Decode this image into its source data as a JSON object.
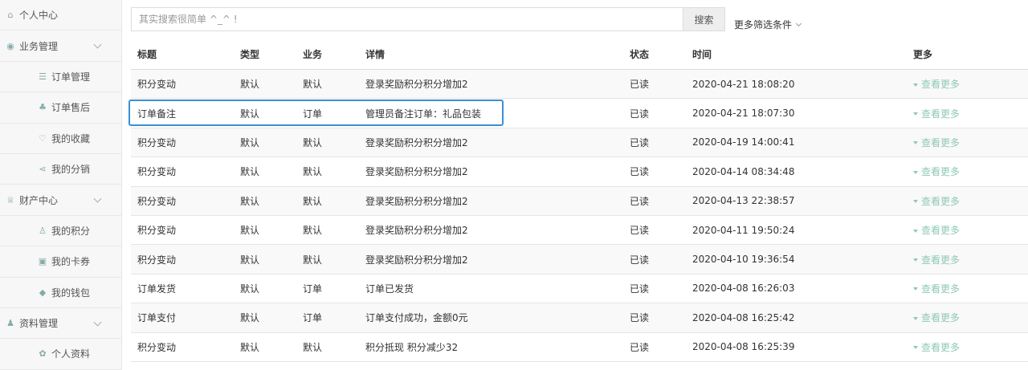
{
  "sidebar": {
    "items": [
      {
        "label": "个人中心",
        "level": "top",
        "icon": "home-icon",
        "glyph": "⌂",
        "expandable": false
      },
      {
        "label": "业务管理",
        "level": "top",
        "icon": "business-icon",
        "glyph": "◉",
        "expandable": true
      },
      {
        "label": "订单管理",
        "level": "sub",
        "icon": "list-icon",
        "glyph": "☰",
        "expandable": false
      },
      {
        "label": "订单售后",
        "level": "sub",
        "icon": "after-sale-icon",
        "glyph": "♣",
        "expandable": false
      },
      {
        "label": "我的收藏",
        "level": "sub",
        "icon": "heart-icon",
        "glyph": "♡",
        "expandable": false
      },
      {
        "label": "我的分销",
        "level": "sub",
        "icon": "share-icon",
        "glyph": "⋖",
        "expandable": false
      },
      {
        "label": "财产中心",
        "level": "top",
        "icon": "trophy-icon",
        "glyph": "♕",
        "expandable": true
      },
      {
        "label": "我的积分",
        "level": "sub",
        "icon": "points-icon",
        "glyph": "♙",
        "expandable": false
      },
      {
        "label": "我的卡券",
        "level": "sub",
        "icon": "gift-icon",
        "glyph": "▣",
        "expandable": false
      },
      {
        "label": "我的钱包",
        "level": "sub",
        "icon": "wallet-icon",
        "glyph": "◆",
        "expandable": false
      },
      {
        "label": "资料管理",
        "level": "top",
        "icon": "user-icon",
        "glyph": "♟",
        "expandable": true
      },
      {
        "label": "个人资料",
        "level": "sub",
        "icon": "settings-icon",
        "glyph": "✿",
        "expandable": false
      }
    ]
  },
  "search": {
    "placeholder": "其实搜索很简单 ^_^ !",
    "button_label": "搜索",
    "more_filters_label": "更多筛选条件"
  },
  "table": {
    "headers": {
      "title": "标题",
      "type": "类型",
      "business": "业务",
      "detail": "详情",
      "status": "状态",
      "time": "时间",
      "more": "更多"
    },
    "more_link_label": "查看更多",
    "highlighted_row": 1,
    "rows": [
      {
        "title": "积分变动",
        "type": "默认",
        "business": "默认",
        "detail": "登录奖励积分积分增加2",
        "status": "已读",
        "time": "2020-04-21 18:08:20"
      },
      {
        "title": "订单备注",
        "type": "默认",
        "business": "订单",
        "detail": "管理员备注订单：礼品包装",
        "status": "已读",
        "time": "2020-04-21 18:07:30"
      },
      {
        "title": "积分变动",
        "type": "默认",
        "business": "默认",
        "detail": "登录奖励积分积分增加2",
        "status": "已读",
        "time": "2020-04-19 14:00:41"
      },
      {
        "title": "积分变动",
        "type": "默认",
        "business": "默认",
        "detail": "登录奖励积分积分增加2",
        "status": "已读",
        "time": "2020-04-14 08:34:48"
      },
      {
        "title": "积分变动",
        "type": "默认",
        "business": "默认",
        "detail": "登录奖励积分积分增加2",
        "status": "已读",
        "time": "2020-04-13 22:38:57"
      },
      {
        "title": "积分变动",
        "type": "默认",
        "business": "默认",
        "detail": "登录奖励积分积分增加2",
        "status": "已读",
        "time": "2020-04-11 19:50:24"
      },
      {
        "title": "积分变动",
        "type": "默认",
        "business": "默认",
        "detail": "登录奖励积分积分增加2",
        "status": "已读",
        "time": "2020-04-10 19:36:54"
      },
      {
        "title": "订单发货",
        "type": "默认",
        "business": "订单",
        "detail": "订单已发货",
        "status": "已读",
        "time": "2020-04-08 16:26:03"
      },
      {
        "title": "订单支付",
        "type": "默认",
        "business": "订单",
        "detail": "订单支付成功，金额0元",
        "status": "已读",
        "time": "2020-04-08 16:25:42"
      },
      {
        "title": "积分变动",
        "type": "默认",
        "business": "默认",
        "detail": "积分抵现 积分减少32",
        "status": "已读",
        "time": "2020-04-08 16:25:39"
      }
    ]
  },
  "colors": {
    "accent": "#3a8fd6",
    "more_link": "#8fc9b4",
    "sidebar_bg": "#f7f7f7"
  }
}
